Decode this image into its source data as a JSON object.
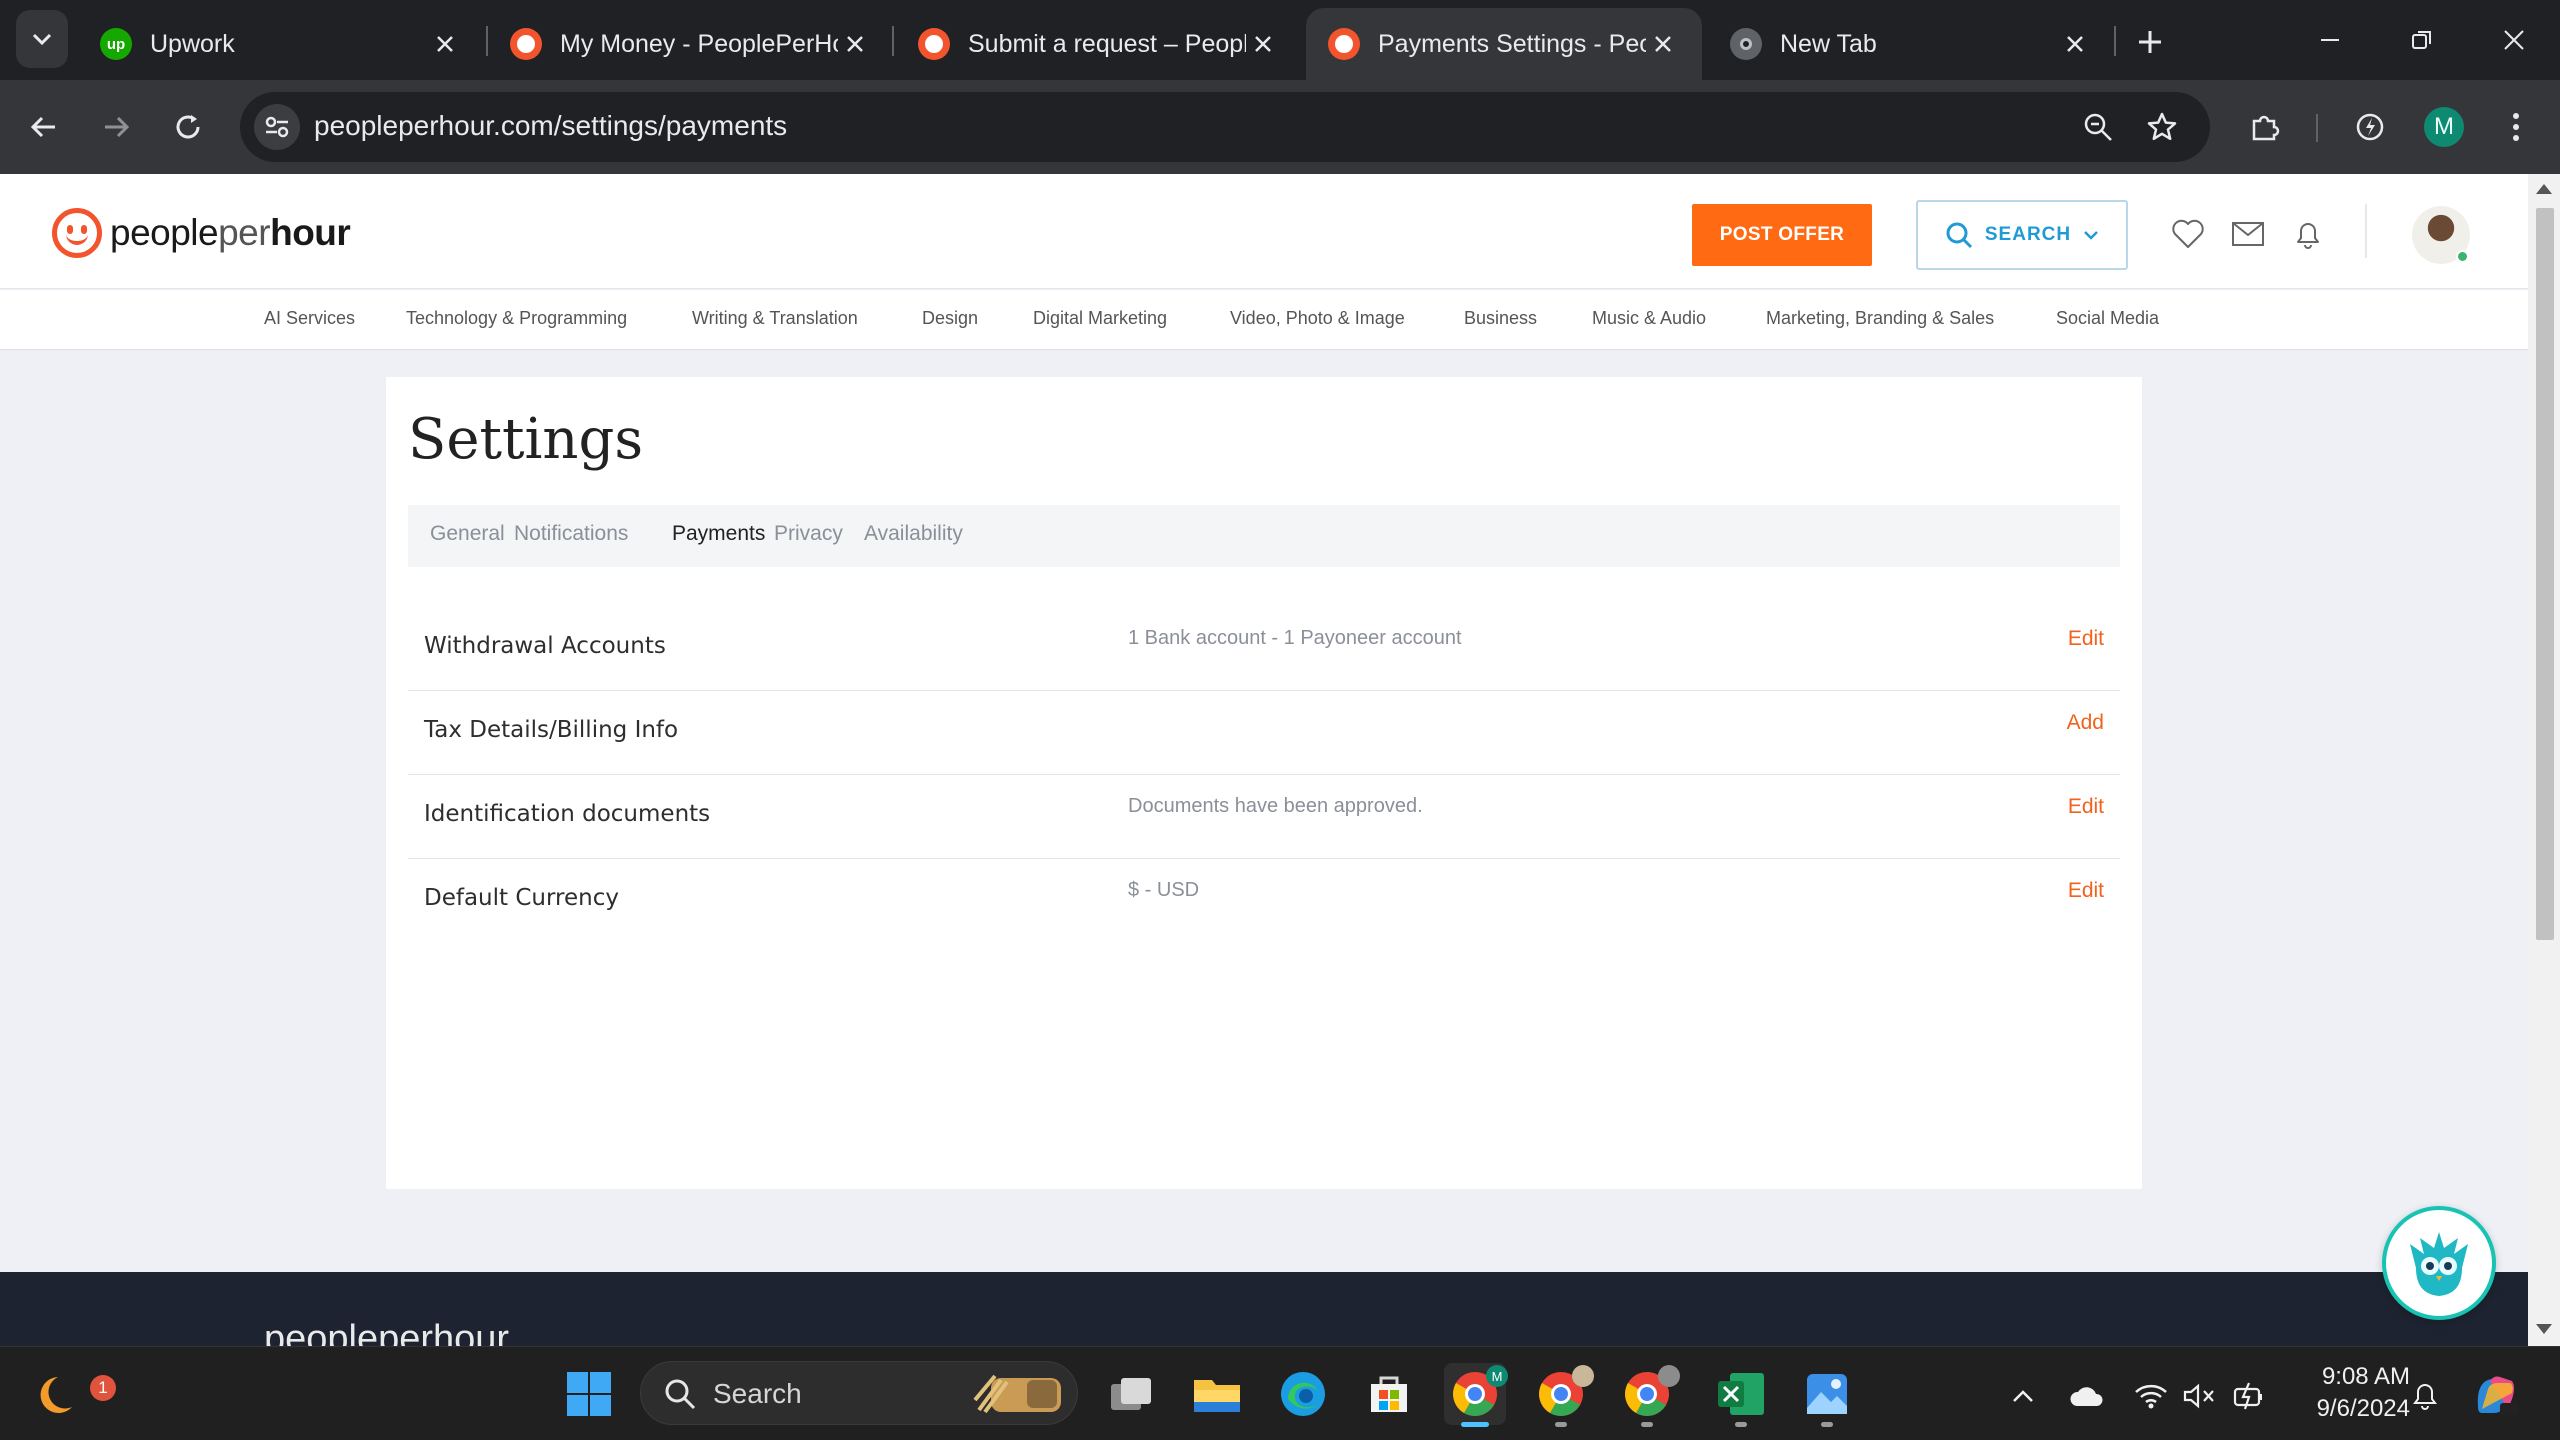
{
  "browser": {
    "tabs": [
      {
        "title": "Upwork",
        "favicon": "upwork-icon",
        "active": false
      },
      {
        "title": "My Money - PeoplePerHour",
        "favicon": "peopleperhour-icon",
        "active": false
      },
      {
        "title": "Submit a request – PeoplePerHour",
        "favicon": "peopleperhour-icon",
        "active": false
      },
      {
        "title": "Payments Settings - PeoplePerHour",
        "favicon": "peopleperhour-icon",
        "active": true
      },
      {
        "title": "New Tab",
        "favicon": "chrome-icon",
        "active": false
      }
    ],
    "url": "peopleperhour.com/settings/payments",
    "profile_initial": "M"
  },
  "site": {
    "logo": {
      "people": "people",
      "per": "per",
      "hour": "hour"
    },
    "post_offer_label": "POST OFFER",
    "search_label": "SEARCH",
    "categories": [
      "AI Services",
      "Technology & Programming",
      "Writing & Translation",
      "Design",
      "Digital Marketing",
      "Video, Photo & Image",
      "Business",
      "Music & Audio",
      "Marketing, Branding & Sales",
      "Social Media"
    ]
  },
  "settings": {
    "title": "Settings",
    "tabs": [
      "General",
      "Notifications",
      "Payments",
      "Privacy",
      "Availability"
    ],
    "active_tab": "Payments",
    "rows": [
      {
        "label": "Withdrawal Accounts",
        "value": "1 Bank account - 1 Payoneer account",
        "action": "Edit"
      },
      {
        "label": "Tax Details/Billing Info",
        "value": "",
        "action": "Add"
      },
      {
        "label": "Identification documents",
        "value": "Documents have been approved.",
        "action": "Edit"
      },
      {
        "label": "Default Currency",
        "value": "$ - USD",
        "action": "Edit"
      }
    ]
  },
  "footer": {
    "logo_text": "peopleperhour"
  },
  "taskbar": {
    "search_placeholder": "Search",
    "weather_badge": "1",
    "time": "9:08 AM",
    "date": "9/6/2024",
    "chrome_profile_initial": "M"
  },
  "colors": {
    "accent_orange": "#ff6a13",
    "link_orange": "#f2621c",
    "search_blue": "#1f9ad6",
    "page_bg": "#eef0f6"
  }
}
